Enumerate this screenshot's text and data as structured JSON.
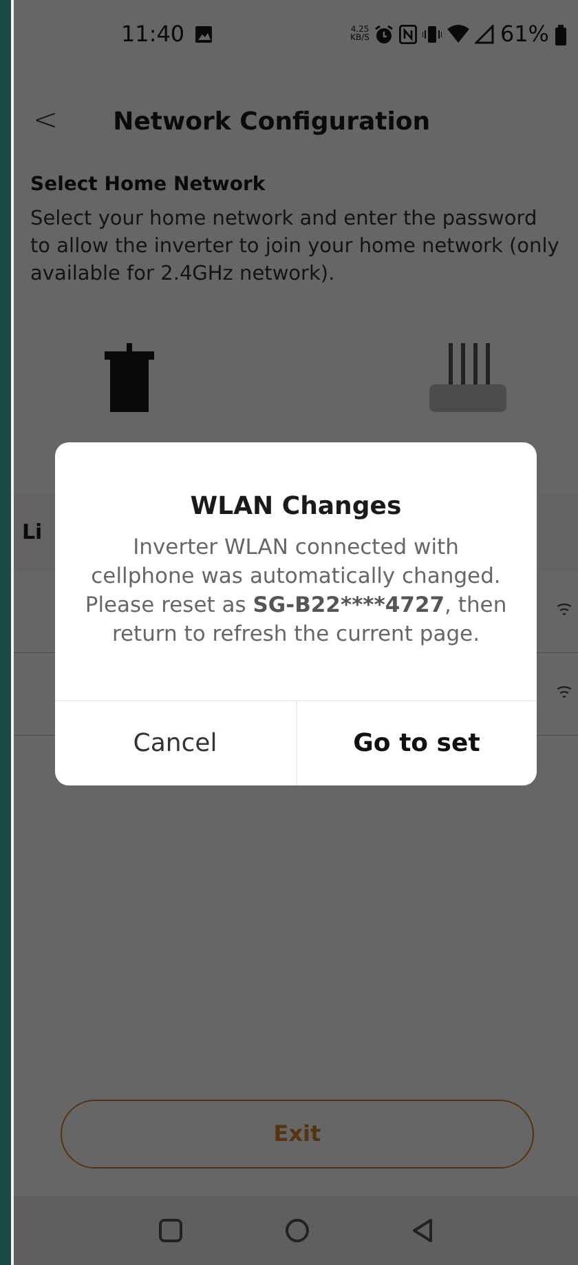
{
  "status_bar": {
    "time": "11:40",
    "speed": "4.25",
    "speed_unit": "KB/S",
    "battery": "61%"
  },
  "header": {
    "back": "<",
    "title": "Network Configuration"
  },
  "section": {
    "title": "Select Home Network",
    "description": "Select your home network and enter the password to allow the inverter to join your home network (only available for 2.4GHz network)."
  },
  "list": {
    "header": "Li",
    "rows": [
      {
        "kind": "wifi"
      },
      {
        "kind": "wifi"
      }
    ]
  },
  "dialog": {
    "title": "WLAN Changes",
    "message_before": "Inverter WLAN connected with cellphone was automatically changed. Please reset as ",
    "message_bold": "SG-B22****4727",
    "message_after": ", then return to refresh the current page.",
    "buttons": [
      {
        "label": "Cancel",
        "kind": "cancel"
      },
      {
        "label": "Go to set",
        "kind": "confirm"
      }
    ]
  },
  "exit_button": "Exit"
}
